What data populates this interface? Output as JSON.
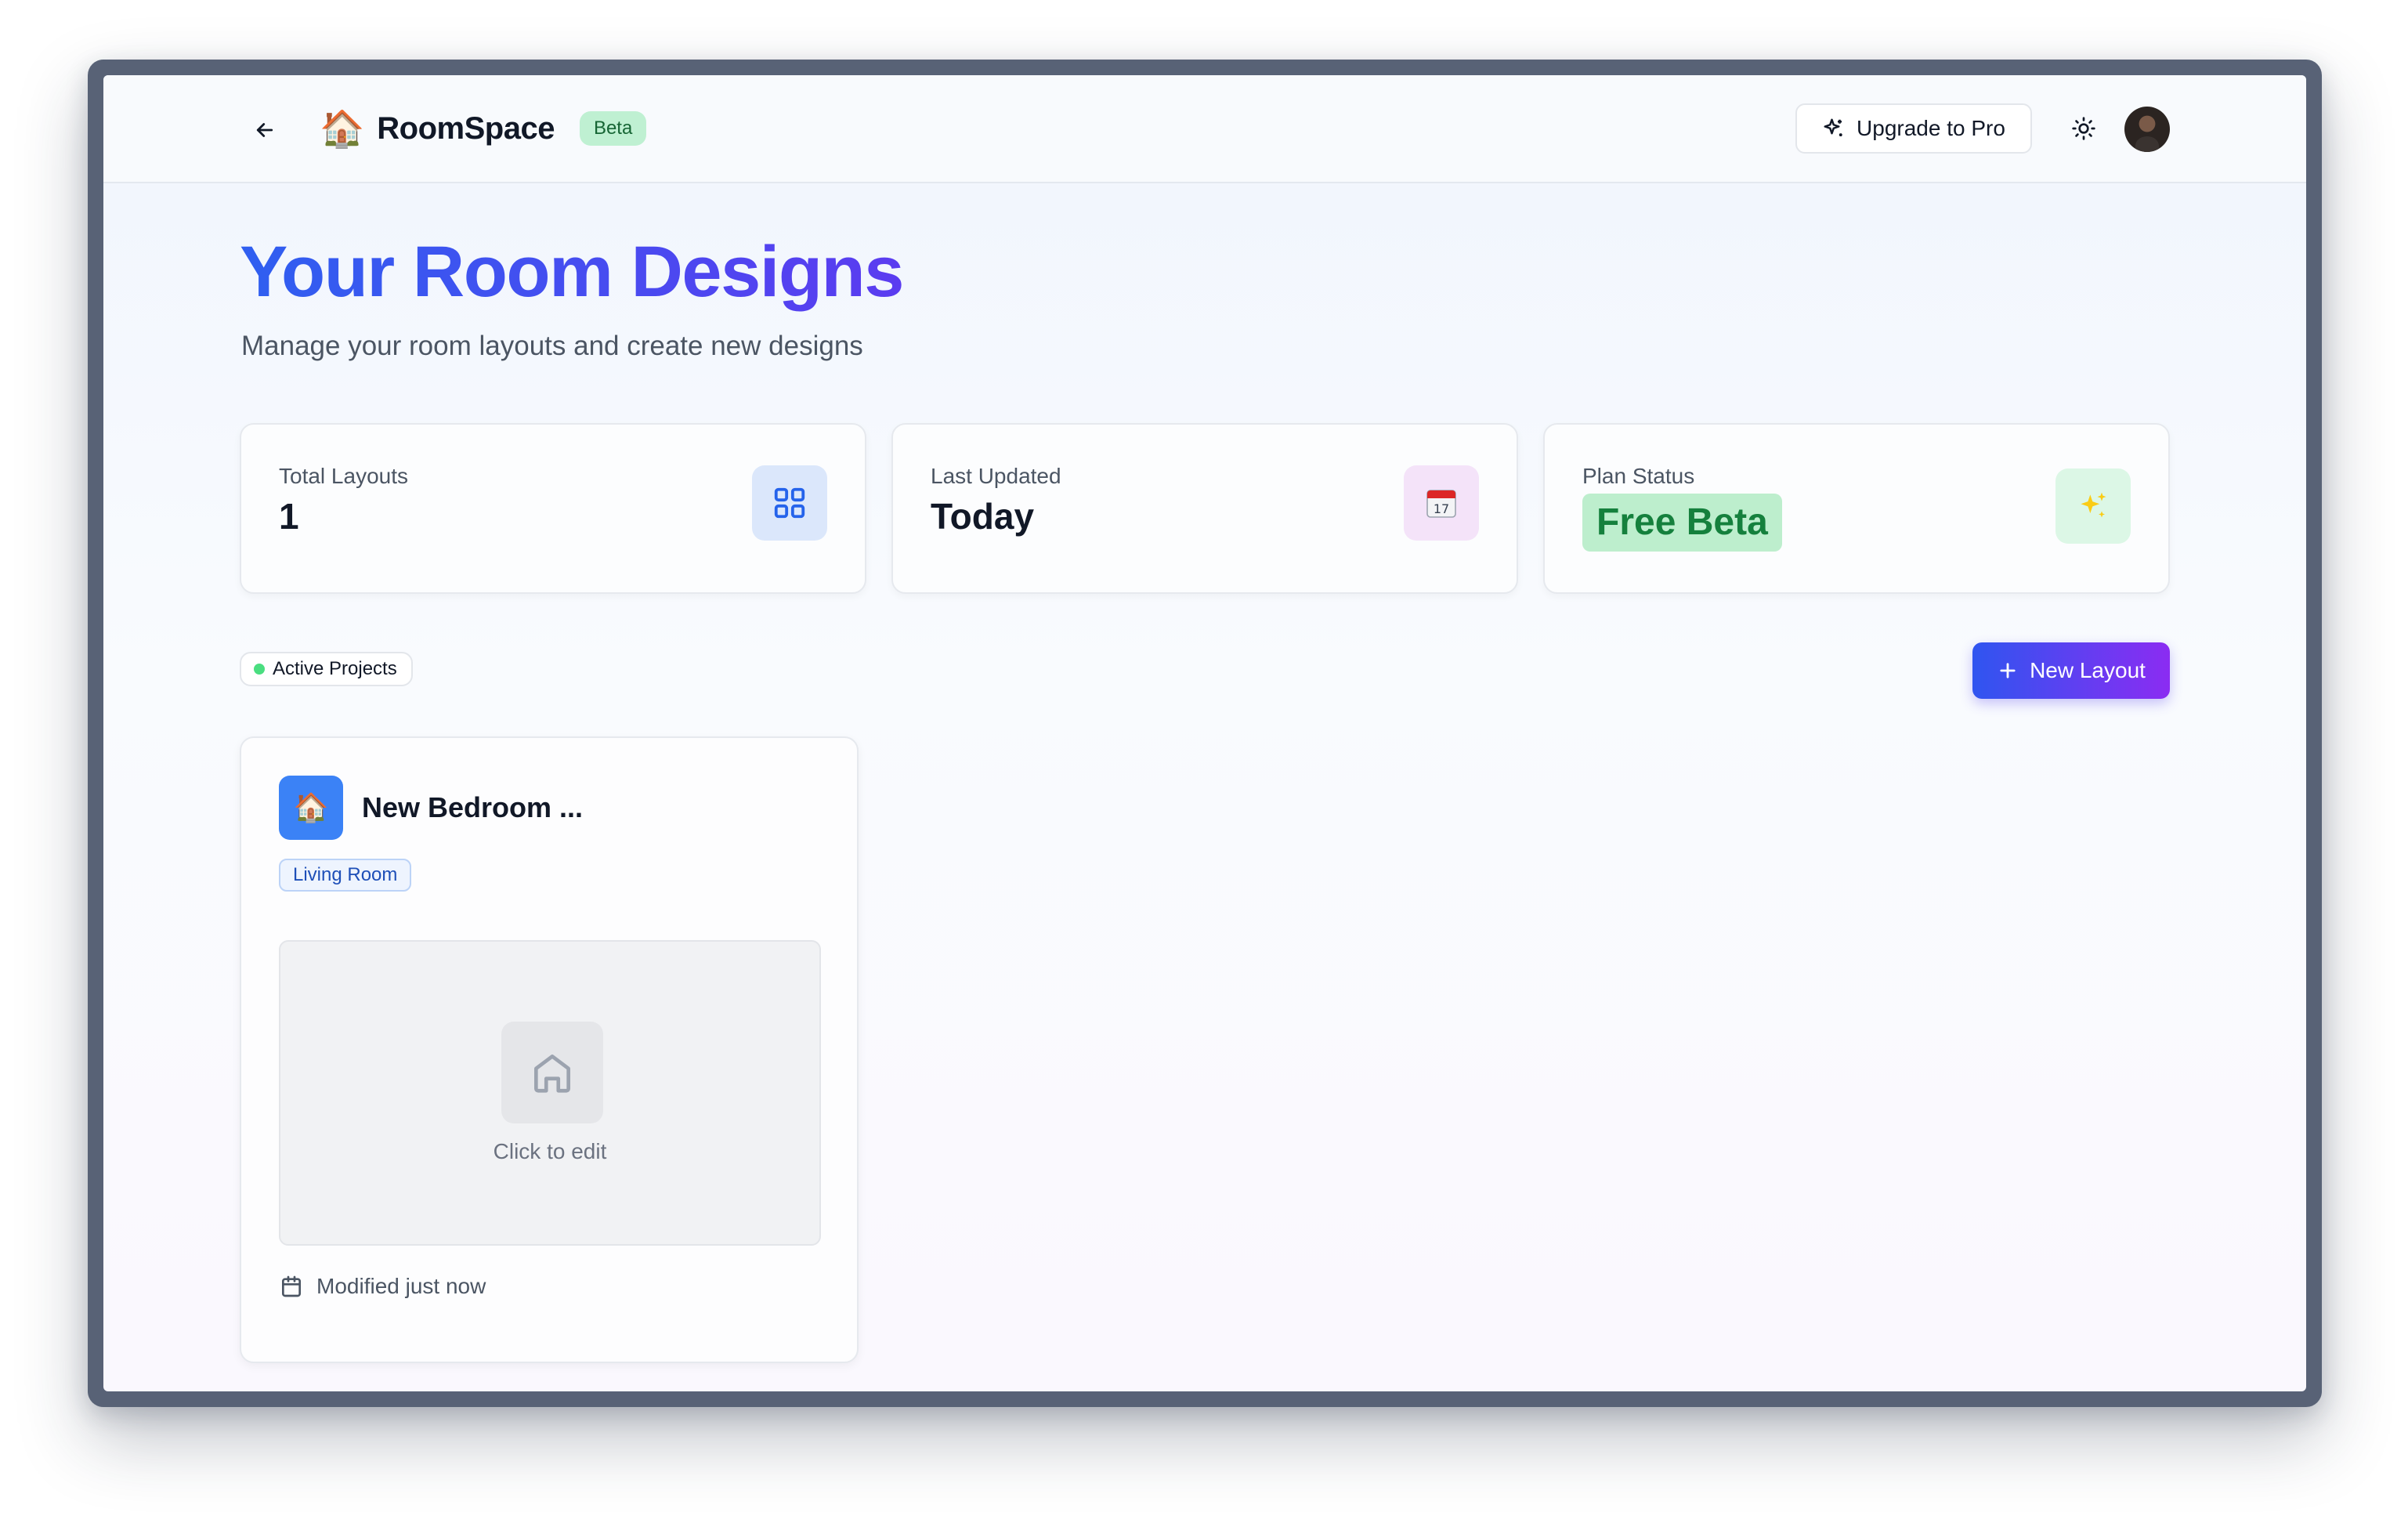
{
  "header": {
    "logo_emoji": "🏠",
    "app_name": "RoomSpace",
    "badge": "Beta",
    "upgrade_label": "Upgrade to Pro"
  },
  "page": {
    "title": "Your Room Designs",
    "subtitle": "Manage your room layouts and create new designs"
  },
  "stats": [
    {
      "label": "Total Layouts",
      "value": "1",
      "icon": "grid-icon"
    },
    {
      "label": "Last Updated",
      "value": "Today",
      "icon": "calendar-icon"
    },
    {
      "label": "Plan Status",
      "value": "Free Beta",
      "icon": "sparkles-icon"
    }
  ],
  "section": {
    "active_label": "Active Projects",
    "new_layout_label": "New Layout"
  },
  "layouts": [
    {
      "title": "New Bedroom ...",
      "room_type": "Living Room",
      "preview_text": "Click to edit",
      "modified": "Modified just now"
    }
  ],
  "colors": {
    "accent_start": "#2f55f0",
    "accent_end": "#8b2cf2",
    "beta_bg": "#bff0d2",
    "free_beta_text": "#15803d",
    "card_icon_bg": "#3b82f6"
  }
}
